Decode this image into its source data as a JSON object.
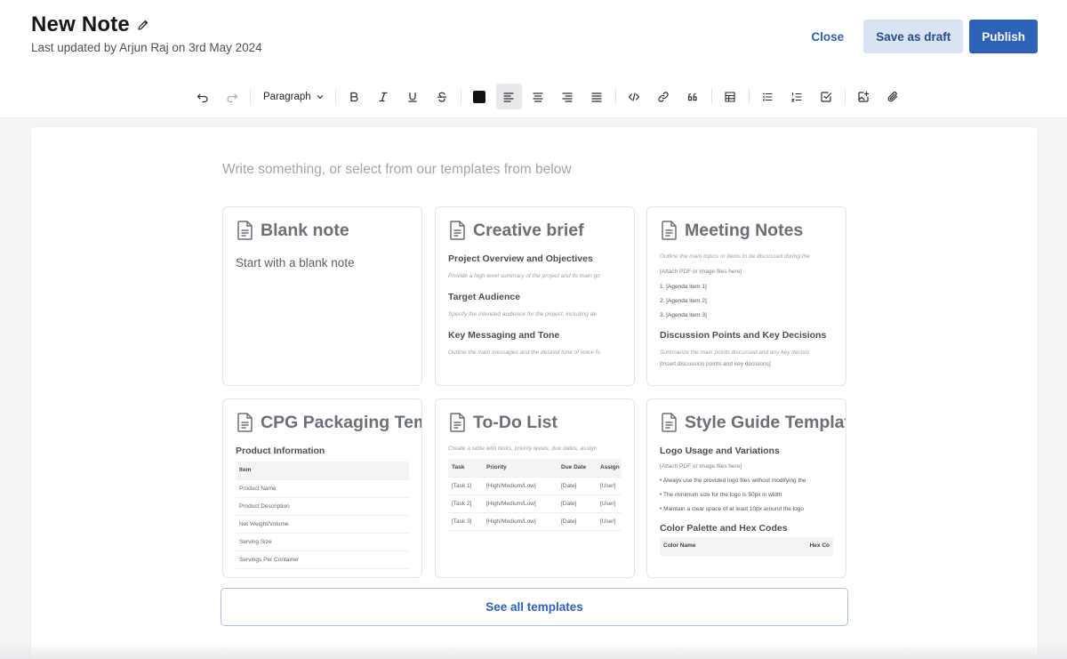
{
  "header": {
    "title": "New Note",
    "subtitle": "Last updated by Arjun Raj on 3rd May 2024",
    "close_label": "Close",
    "draft_label": "Save as draft",
    "publish_label": "Publish"
  },
  "toolbar": {
    "block_style": "Paragraph",
    "text_color": "#111111",
    "active_alignment": "align-left"
  },
  "editor": {
    "placeholder": "Write something, or select from our templates from below"
  },
  "templates": {
    "blank": {
      "title": "Blank note",
      "text": "Start with a blank note"
    },
    "creative": {
      "title": "Creative brief",
      "h1": "Project Overview and Objectives",
      "i1": "Provide a high-level summary of the project and its main go",
      "h2": "Target Audience",
      "i2": "Specify the intended audience for the project, including de",
      "h3": "Key Messaging and Tone",
      "i3": "Outline the main messages and the desired tone of voice fo"
    },
    "meeting": {
      "title": "Meeting Notes",
      "s1": "Outline the main topics or items to be discussed during the",
      "s2": "[Attach PDF or image files here]",
      "l1": "1. [Agenda item 1]",
      "l2": "2. [Agenda item 2]",
      "l3": "3. [Agenda item 3]",
      "h1": "Discussion Points and Key Decisions",
      "s3": "Summarize the main points discussed and any key decisio",
      "s4": "[Insert discussion points and key decisions]"
    },
    "cpg": {
      "title": "CPG Packaging Template",
      "h1": "Product Information",
      "table_header": "Item",
      "rows": [
        "Product Name",
        "Product Description",
        "Net Weight/Volume",
        "Serving Size",
        "Servings Per Container"
      ]
    },
    "todo": {
      "title": "To-Do List",
      "intro": "Create a table with tasks, priority levels, due dates, assign",
      "columns": [
        "Task",
        "Priority",
        "Due Date",
        "Assign"
      ],
      "rows": [
        [
          "[Task 1]",
          "[High/Medium/Low]",
          "[Date]",
          "[User]"
        ],
        [
          "[Task 2]",
          "[High/Medium/Low]",
          "[Date]",
          "[User]"
        ],
        [
          "[Task 3]",
          "[High/Medium/Low]",
          "[Date]",
          "[User]"
        ]
      ]
    },
    "style": {
      "title": "Style Guide Template",
      "h1": "Logo Usage and Variations",
      "s1": "[Attach PDF or image files here]",
      "b1": "Always use the provided logo files without modifying the",
      "b2": "The minimum size for the logo is 50px in width",
      "b3": "Maintain a clear space of at least 10px around the logo",
      "h2": "Color Palette and Hex Codes",
      "col1": "Color Name",
      "col2": "Hex Co"
    },
    "see_all_label": "See all templates"
  }
}
